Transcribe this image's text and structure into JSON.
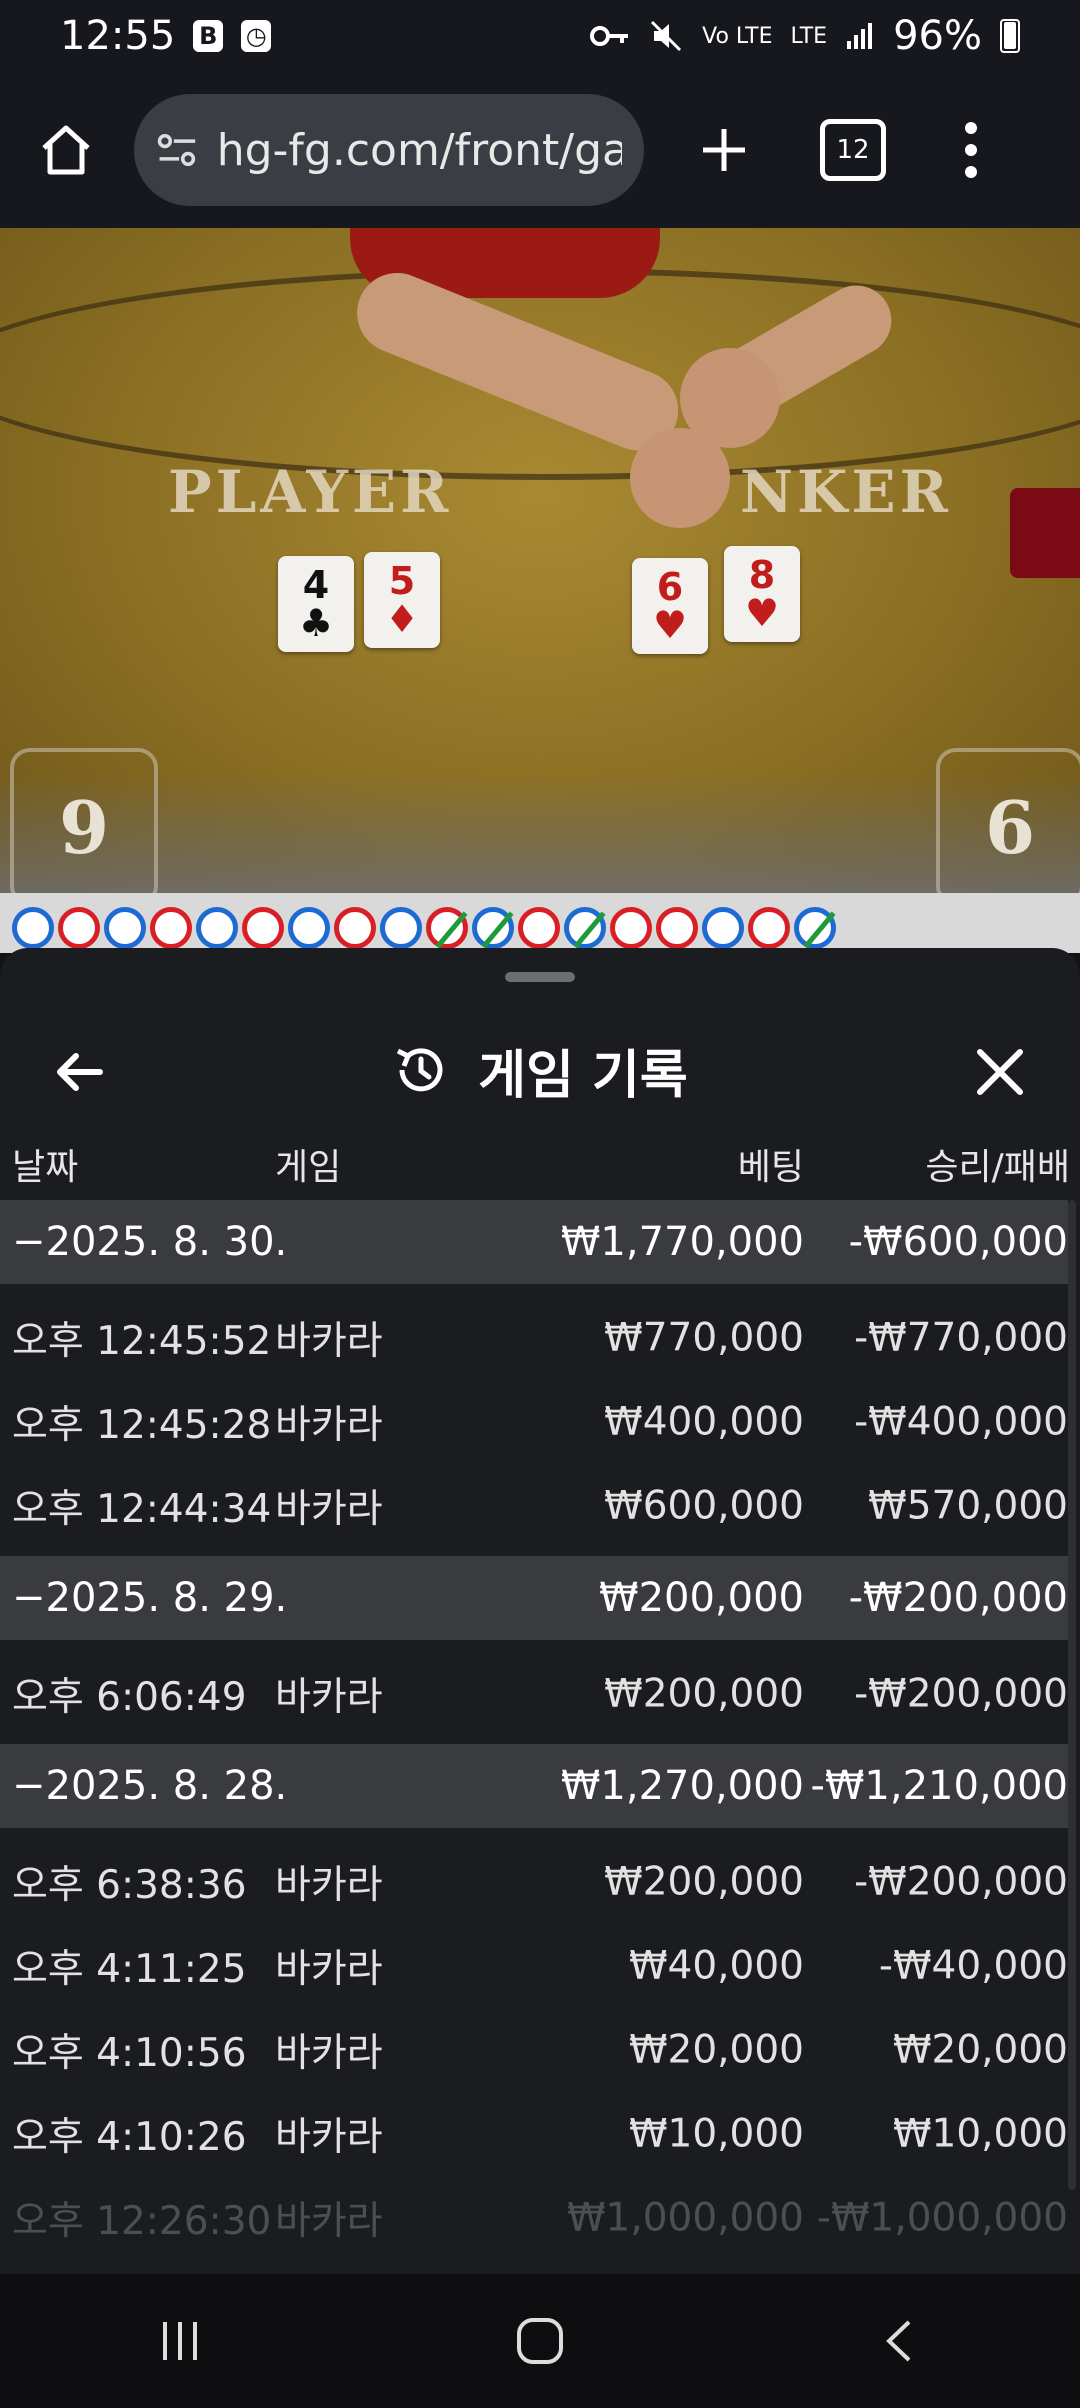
{
  "status_bar": {
    "time": "12:55",
    "app_badges": [
      "B",
      "clock-badge"
    ],
    "network": "LTE",
    "signal_label": "Vo LTE",
    "battery": "96%"
  },
  "browser": {
    "url": "hg-fg.com/front/gam",
    "tab_count": "12"
  },
  "game_view": {
    "player_label": "PLAYER",
    "banker_label": "NKER",
    "player_cards": [
      {
        "rank": "4",
        "suit": "♣",
        "color": "black"
      },
      {
        "rank": "5",
        "suit": "♦",
        "color": "red"
      }
    ],
    "banker_cards": [
      {
        "rank": "6",
        "suit": "♥",
        "color": "red"
      },
      {
        "rank": "8",
        "suit": "♥",
        "color": "red"
      }
    ],
    "player_score": "9",
    "banker_score": "6"
  },
  "road": {
    "beads": [
      "blue",
      "red",
      "blue",
      "red",
      "blue",
      "red",
      "blue",
      "red",
      "blue",
      "red-tie",
      "blue-tie",
      "red",
      "blue-tie",
      "red",
      "red",
      "blue",
      "red",
      "blue-tie"
    ]
  },
  "sheet": {
    "title": "게임 기록",
    "columns": {
      "date": "날짜",
      "game": "게임",
      "bet": "베팅",
      "win_loss": "승리/패배"
    },
    "groups": [
      {
        "date": "−2025. 8. 30.",
        "bet_total": "₩1,770,000",
        "win_total": "-₩600,000",
        "entries": [
          {
            "time": "오후 12:45:52",
            "game": "바카라",
            "bet": "₩770,000",
            "win": "-₩770,000"
          },
          {
            "time": "오후 12:45:28",
            "game": "바카라",
            "bet": "₩400,000",
            "win": "-₩400,000"
          },
          {
            "time": "오후 12:44:34",
            "game": "바카라",
            "bet": "₩600,000",
            "win": "₩570,000"
          }
        ]
      },
      {
        "date": "−2025. 8. 29.",
        "bet_total": "₩200,000",
        "win_total": "-₩200,000",
        "entries": [
          {
            "time": "오후 6:06:49",
            "game": "바카라",
            "bet": "₩200,000",
            "win": "-₩200,000"
          }
        ]
      },
      {
        "date": "−2025. 8. 28.",
        "bet_total": "₩1,270,000",
        "win_total": "-₩1,210,000",
        "entries": [
          {
            "time": "오후 6:38:36",
            "game": "바카라",
            "bet": "₩200,000",
            "win": "-₩200,000"
          },
          {
            "time": "오후 4:11:25",
            "game": "바카라",
            "bet": "₩40,000",
            "win": "-₩40,000"
          },
          {
            "time": "오후 4:10:56",
            "game": "바카라",
            "bet": "₩20,000",
            "win": "₩20,000"
          },
          {
            "time": "오후 4:10:26",
            "game": "바카라",
            "bet": "₩10,000",
            "win": "₩10,000"
          },
          {
            "time": "오후 12:26:30",
            "game": "바카라",
            "bet": "₩1,000,000",
            "win": "-₩1,000,000"
          }
        ]
      }
    ]
  },
  "colors": {
    "sheet_bg": "#1b1c20",
    "group_row_bg": "#3a3b3f",
    "banker_red": "#d81f26",
    "player_blue": "#1e6ad4",
    "tie_green": "#1f9a3b"
  }
}
